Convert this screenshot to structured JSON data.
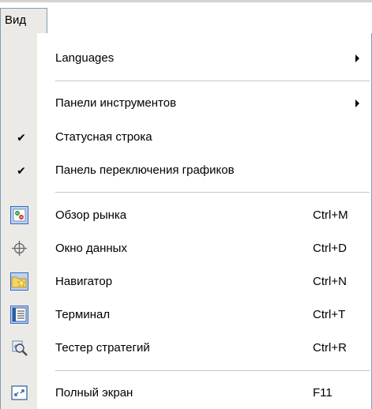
{
  "menubar": {
    "view_label": "Вид"
  },
  "menu": {
    "items": [
      {
        "label": "Languages",
        "submenu": true
      },
      {
        "label": "Панели инструментов",
        "submenu": true
      },
      {
        "label": "Статусная строка",
        "checked": true
      },
      {
        "label": "Панель переключения графиков",
        "checked": true
      },
      {
        "label": "Обзор рынка",
        "shortcut": "Ctrl+M",
        "icon": "market-watch-icon"
      },
      {
        "label": "Окно данных",
        "shortcut": "Ctrl+D",
        "icon": "crosshair-icon"
      },
      {
        "label": "Навигатор",
        "shortcut": "Ctrl+N",
        "icon": "navigator-folder-star-icon"
      },
      {
        "label": "Терминал",
        "shortcut": "Ctrl+T",
        "icon": "terminal-icon"
      },
      {
        "label": "Тестер стратегий",
        "shortcut": "Ctrl+R",
        "icon": "strategy-tester-icon"
      },
      {
        "label": "Полный экран",
        "shortcut": "F11",
        "icon": "fullscreen-icon"
      }
    ],
    "check_glyph": "✔"
  },
  "colors": {
    "icon_strip": "#eceae6",
    "highlight_frame": "#316ac5",
    "highlight_fill": "#c1d2ee"
  }
}
